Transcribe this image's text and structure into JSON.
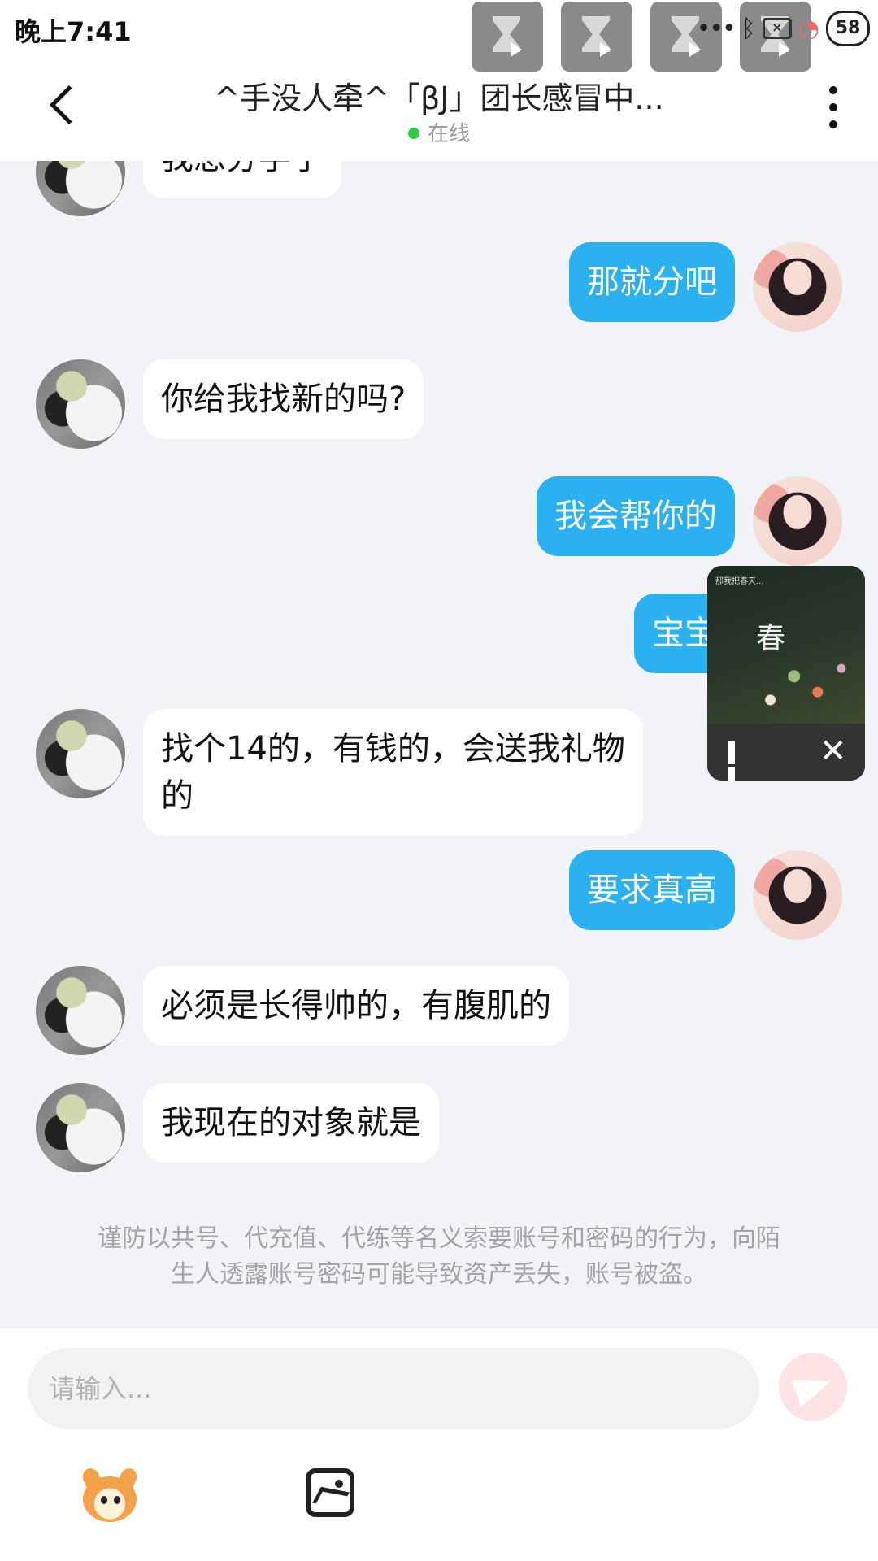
{
  "status_bar": {
    "time": "晚上7:41",
    "battery_badge": "58",
    "dots": "•••"
  },
  "header": {
    "title": "^手没人牵^「βJ」团长感冒中...",
    "status": "在线"
  },
  "messages": [
    {
      "side": "in",
      "text": "我想分手了"
    },
    {
      "side": "out",
      "text": "那就分吧"
    },
    {
      "side": "in",
      "text": "你给我找新的吗?"
    },
    {
      "side": "out",
      "text": "我会帮你的"
    },
    {
      "side": "out",
      "text": "宝宝"
    },
    {
      "side": "in",
      "text_line1": "找个14的，有钱的，会送我礼物",
      "text_line2": "的"
    },
    {
      "side": "out",
      "text": "要求真高"
    },
    {
      "side": "in",
      "text": "必须是长得帅的，有腹肌的"
    },
    {
      "side": "in",
      "text": "我现在的对象就是"
    }
  ],
  "music_player": {
    "cover_small_text": "那我把春天...",
    "cover_title": "春"
  },
  "warning": {
    "line1": "谨防以共号、代充值、代练等名义索要账号和密码的行为，向陌",
    "line2": "生人透露账号密码可能导致资产丢失，账号被盗。"
  },
  "input": {
    "placeholder": "请输入..."
  },
  "colors": {
    "bubble_out": "#2bb1f0",
    "bubble_in": "#ffffff",
    "background": "#f2f3f7",
    "online": "#2ecc40"
  }
}
